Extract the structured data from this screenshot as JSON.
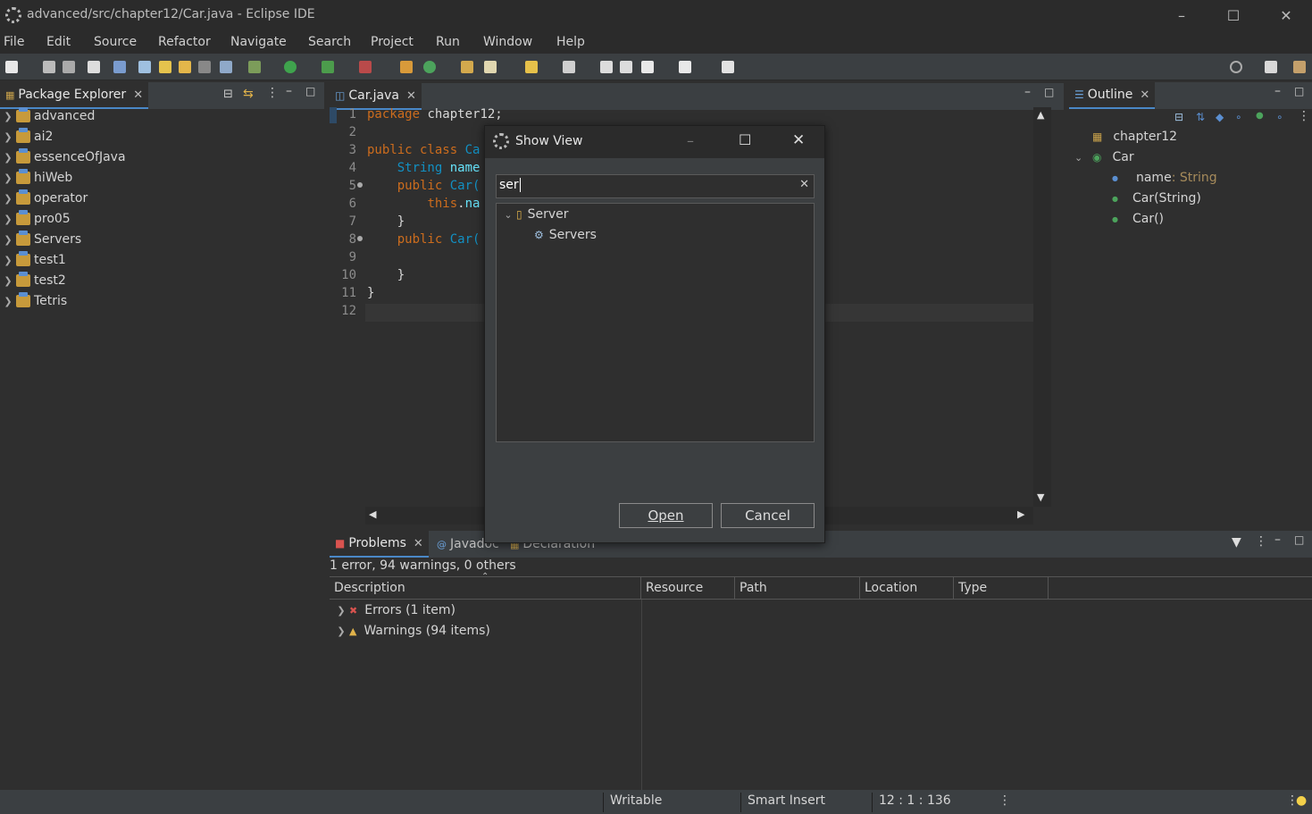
{
  "window": {
    "title": "advanced/src/chapter12/Car.java - Eclipse IDE"
  },
  "menu": [
    "File",
    "Edit",
    "Source",
    "Refactor",
    "Navigate",
    "Search",
    "Project",
    "Run",
    "Window",
    "Help"
  ],
  "package_explorer": {
    "tab_label": "Package Explorer",
    "projects": [
      "advanced",
      "ai2",
      "essenceOfJava",
      "hiWeb",
      "operator",
      "pro05",
      "Servers",
      "test1",
      "test2",
      "Tetris"
    ]
  },
  "editor": {
    "tab_label": "Car.java",
    "line_numbers": [
      "1",
      "2",
      "3",
      "4",
      "5",
      "6",
      "7",
      "8",
      "9",
      "10",
      "11",
      "12"
    ]
  },
  "outline": {
    "tab_label": "Outline",
    "package": "chapter12",
    "class_name": "Car",
    "field_name": "name",
    "field_type": " : String",
    "constructor1": "Car(String)",
    "constructor2": "Car()"
  },
  "problems": {
    "tabs": {
      "problems": "Problems",
      "javadoc": "Javadoc",
      "declaration": "Declaration"
    },
    "summary": "1 error, 94 warnings, 0 others",
    "columns": [
      "Description",
      "Resource",
      "Path",
      "Location",
      "Type"
    ],
    "errors": "Errors (1 item)",
    "warnings": "Warnings (94 items)"
  },
  "status": {
    "writable": "Writable",
    "insert_mode": "Smart Insert",
    "position": "12 : 1 : 136"
  },
  "dialog": {
    "title": "Show View",
    "filter_value": "ser",
    "category": "Server",
    "view_item": "Servers",
    "open_label": "Open",
    "cancel_label": "Cancel"
  },
  "colors": {
    "accent": "#4a88c7",
    "keyword": "#cc6c1d",
    "type": "#1290c3",
    "background": "#2f2f2f"
  }
}
